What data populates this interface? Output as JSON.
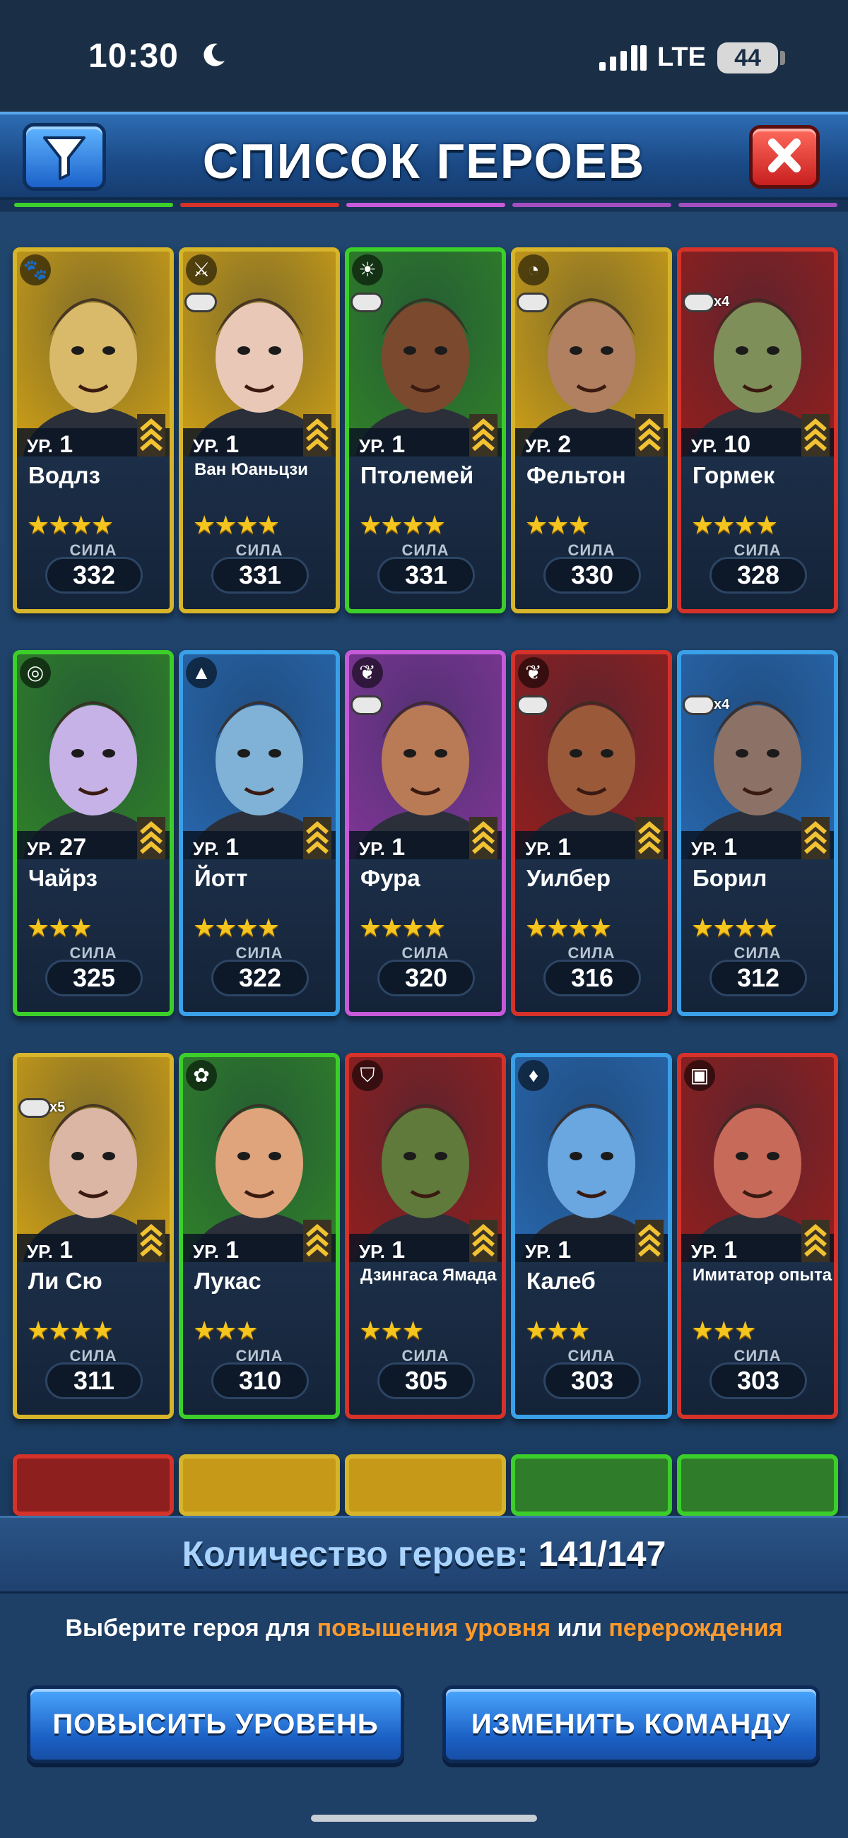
{
  "status_bar": {
    "time": "10:30",
    "network": "LTE",
    "battery": "44"
  },
  "header": {
    "title": "СПИСОК ГЕРОЕВ",
    "filter_icon": "funnel-icon",
    "close_icon": "close-icon"
  },
  "colors": {
    "accent": "#2d6cb3",
    "highlight": "#ff9a2a",
    "star": "#f4c51e"
  },
  "level_prefix": "УР.",
  "power_label": "СИЛА",
  "heroes": [
    {
      "name": "Водлз",
      "level": "1",
      "stars": "★★★★",
      "power": "332",
      "rarity": "gold",
      "element": "paw-icon",
      "mask": false,
      "mask_count": ""
    },
    {
      "name": "Ван Юаньцзи",
      "level": "1",
      "stars": "★★★★",
      "power": "331",
      "rarity": "gold",
      "element": "claw-icon",
      "mask": true,
      "mask_count": ""
    },
    {
      "name": "Птолемей",
      "level": "1",
      "stars": "★★★★",
      "power": "331",
      "rarity": "green",
      "element": "sun-icon",
      "mask": true,
      "mask_count": ""
    },
    {
      "name": "Фельтон",
      "level": "2",
      "stars": "★★★",
      "power": "330",
      "rarity": "gold",
      "element": "horn-icon",
      "mask": true,
      "mask_count": ""
    },
    {
      "name": "Гормек",
      "level": "10",
      "stars": "★★★★",
      "power": "328",
      "rarity": "red",
      "element": "none",
      "mask": true,
      "mask_count": "x4"
    },
    {
      "name": "Чайрз",
      "level": "27",
      "stars": "★★★",
      "power": "325",
      "rarity": "green",
      "element": "swirl-icon",
      "mask": false,
      "mask_count": ""
    },
    {
      "name": "Йотт",
      "level": "1",
      "stars": "★★★★",
      "power": "322",
      "rarity": "blue",
      "element": "mountain-icon",
      "mask": false,
      "mask_count": ""
    },
    {
      "name": "Фура",
      "level": "1",
      "stars": "★★★★",
      "power": "320",
      "rarity": "purple",
      "element": "leaf-icon",
      "mask": true,
      "mask_count": ""
    },
    {
      "name": "Уилбер",
      "level": "1",
      "stars": "★★★★",
      "power": "316",
      "rarity": "red",
      "element": "leaf-icon",
      "mask": true,
      "mask_count": ""
    },
    {
      "name": "Борил",
      "level": "1",
      "stars": "★★★★",
      "power": "312",
      "rarity": "blue",
      "element": "none",
      "mask": true,
      "mask_count": "x4"
    },
    {
      "name": "Ли Сю",
      "level": "1",
      "stars": "★★★★",
      "power": "311",
      "rarity": "gold",
      "element": "none",
      "mask": true,
      "mask_count": "x5"
    },
    {
      "name": "Лукас",
      "level": "1",
      "stars": "★★★",
      "power": "310",
      "rarity": "green",
      "element": "flower-icon",
      "mask": false,
      "mask_count": ""
    },
    {
      "name": "Дзингаса Ямада",
      "level": "1",
      "stars": "★★★",
      "power": "305",
      "rarity": "red",
      "element": "bell-icon",
      "mask": false,
      "mask_count": ""
    },
    {
      "name": "Калеб",
      "level": "1",
      "stars": "★★★",
      "power": "303",
      "rarity": "blue",
      "element": "carrot-icon",
      "mask": false,
      "mask_count": ""
    },
    {
      "name": "Имитатор опыта",
      "level": "1",
      "stars": "★★★",
      "power": "303",
      "rarity": "red",
      "element": "chest-icon",
      "mask": false,
      "mask_count": ""
    }
  ],
  "footer": {
    "count_label": "Количество героев:",
    "count_value": "141/147",
    "hint_pre": "Выберите героя для ",
    "hint_levelup": "повышения уровня",
    "hint_mid": " или ",
    "hint_rebirth": "перерождения",
    "btn_levelup": "ПОВЫСИТЬ УРОВЕНЬ",
    "btn_team": "ИЗМЕНИТЬ КОМАНДУ"
  }
}
